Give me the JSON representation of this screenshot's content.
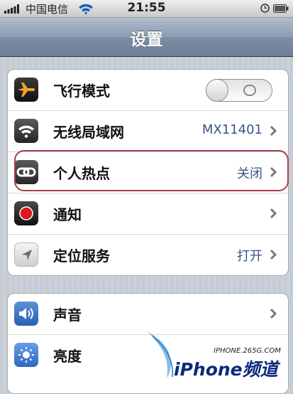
{
  "status_bar": {
    "carrier": "中国电信",
    "time": "21:55"
  },
  "nav": {
    "title": "设置"
  },
  "groups": [
    {
      "items": [
        {
          "label": "飞行模式",
          "icon": "airplane-icon",
          "control": "toggle",
          "toggle_on": false
        },
        {
          "label": "无线局域网",
          "icon": "wifi-icon",
          "value": "MX11401"
        },
        {
          "label": "个人热点",
          "icon": "link-icon",
          "value": "关闭",
          "highlighted": true
        },
        {
          "label": "通知",
          "icon": "notification-icon"
        },
        {
          "label": "定位服务",
          "icon": "location-icon",
          "value": "打开"
        }
      ]
    },
    {
      "items": [
        {
          "label": "声音",
          "icon": "speaker-icon"
        },
        {
          "label": "亮度",
          "icon": "brightness-icon"
        }
      ]
    }
  ],
  "watermark": {
    "url": "IPHONE.265G.COM",
    "brand": "iPhone频道"
  },
  "colors": {
    "nav_bar": "#8d9cb0",
    "value_text": "#385487",
    "highlight_border": "#a6404a",
    "background": "#c5ccd4"
  }
}
